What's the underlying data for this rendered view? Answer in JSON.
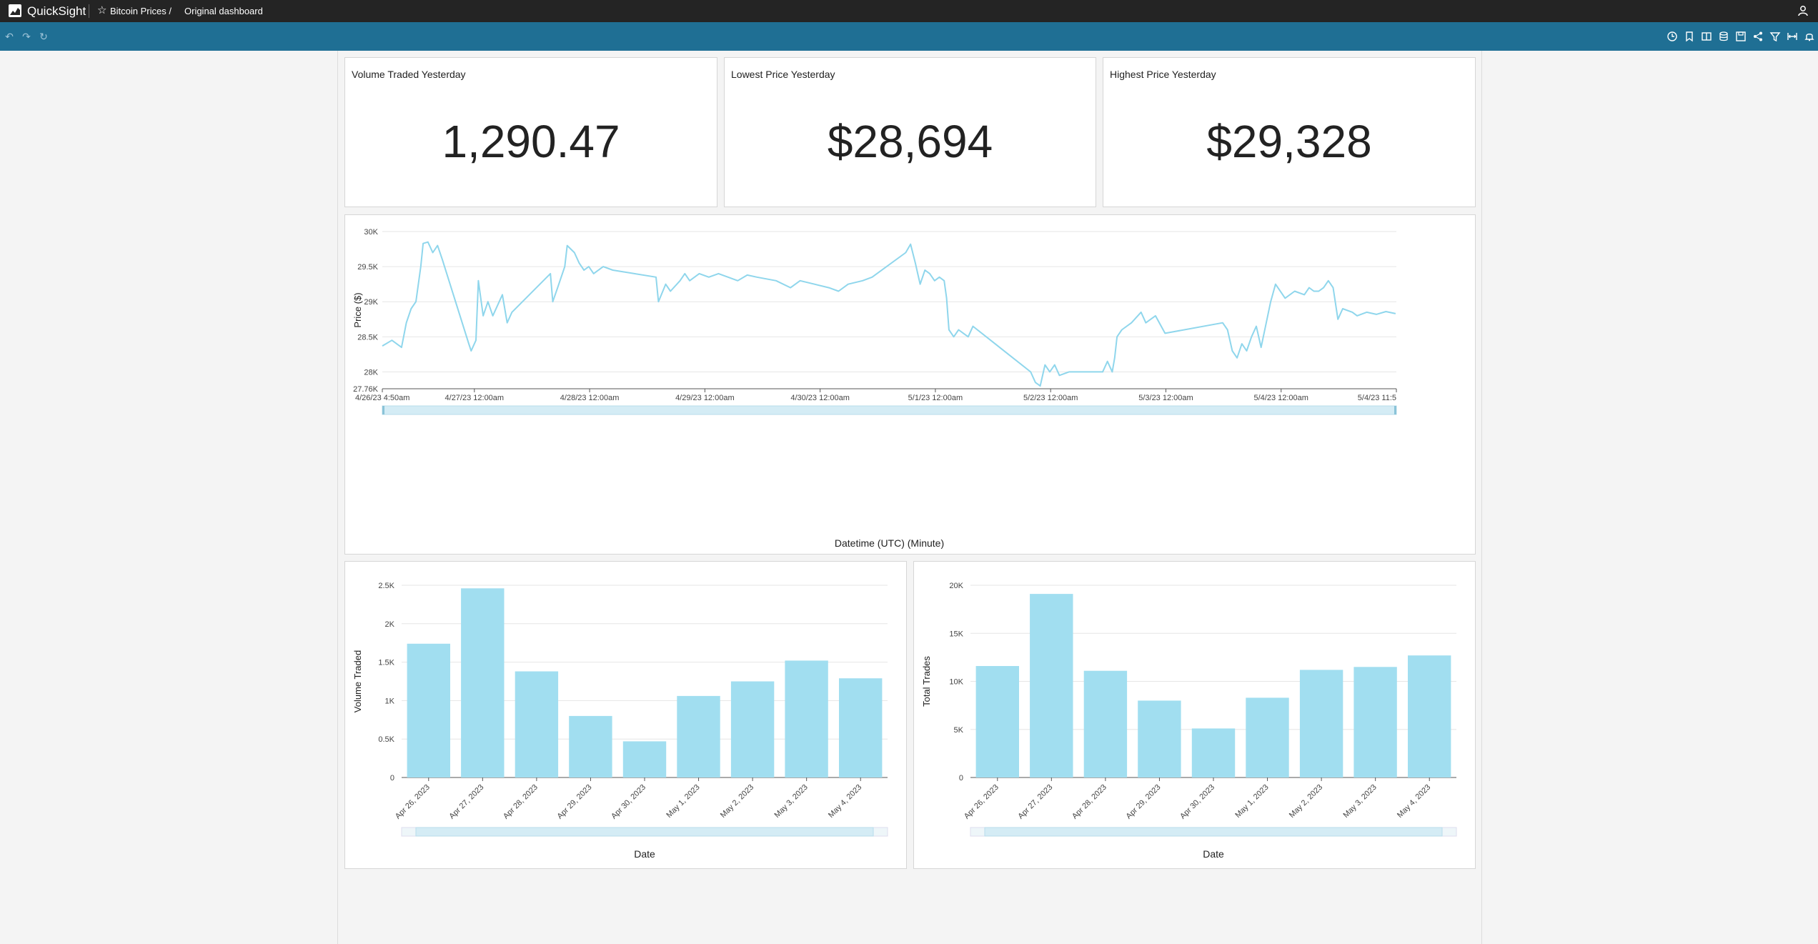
{
  "app": {
    "name": "QuickSight",
    "breadcrumb": "Bitcoin Prices /",
    "dashboard_title": "Original dashboard"
  },
  "toolbar": {
    "left_icons": [
      "undo-icon",
      "redo-icon",
      "reset-icon"
    ],
    "right_icons": [
      "clock-icon",
      "bookmark-icon",
      "thresholds-icon",
      "data-icon",
      "save-icon",
      "share-icon",
      "filter-icon",
      "fit-width-icon",
      "alert-icon"
    ]
  },
  "kpis": [
    {
      "title": "Volume Traded Yesterday",
      "value": "1,290.47"
    },
    {
      "title": "Lowest Price Yesterday",
      "value": "$28,694"
    },
    {
      "title": "Highest Price Yesterday",
      "value": "$29,328"
    }
  ],
  "colors": {
    "series": "#8fd6ec",
    "bar": "#a1def0",
    "topbar": "#242424",
    "toolbar": "#1f6f94"
  },
  "chart_data": [
    {
      "type": "line",
      "ylabel": "Price ($)",
      "xlabel": "Datetime (UTC) (Minute)",
      "y_ticks": [
        "27.76K",
        "28K",
        "28.5K",
        "29K",
        "29.5K",
        "30K"
      ],
      "ylim": [
        27760,
        30000
      ],
      "x_ticks": [
        "4/26/23 4:50am",
        "4/27/23 12:00am",
        "4/28/23 12:00am",
        "4/29/23 12:00am",
        "4/30/23 12:00am",
        "5/1/23 12:00am",
        "5/2/23 12:00am",
        "5/3/23 12:00am",
        "5/4/23 12:00am",
        "5/4/23 11:5"
      ],
      "x_hours": [
        0,
        19.17,
        43.17,
        67.17,
        91.17,
        115.17,
        139.17,
        163.17,
        187.17,
        211.17
      ],
      "grid": true,
      "points": [
        [
          0,
          28370
        ],
        [
          2,
          28450
        ],
        [
          4,
          28350
        ],
        [
          5,
          28700
        ],
        [
          6,
          28900
        ],
        [
          7,
          29000
        ],
        [
          8,
          29500
        ],
        [
          8.5,
          29830
        ],
        [
          9.5,
          29850
        ],
        [
          10.5,
          29700
        ],
        [
          11.5,
          29800
        ],
        [
          12.5,
          29600
        ],
        [
          18,
          28400
        ],
        [
          18.5,
          28300
        ],
        [
          19.5,
          28450
        ],
        [
          20,
          29300
        ],
        [
          21,
          28800
        ],
        [
          22,
          29000
        ],
        [
          23,
          28800
        ],
        [
          25,
          29100
        ],
        [
          26,
          28700
        ],
        [
          27,
          28850
        ],
        [
          35,
          29400
        ],
        [
          35.5,
          29000
        ],
        [
          36.5,
          29200
        ],
        [
          38,
          29500
        ],
        [
          38.5,
          29800
        ],
        [
          40,
          29700
        ],
        [
          41,
          29550
        ],
        [
          42,
          29450
        ],
        [
          43,
          29500
        ],
        [
          44,
          29400
        ],
        [
          46,
          29500
        ],
        [
          48,
          29450
        ],
        [
          57,
          29350
        ],
        [
          57.5,
          29000
        ],
        [
          59,
          29250
        ],
        [
          60,
          29150
        ],
        [
          62,
          29300
        ],
        [
          63,
          29400
        ],
        [
          64,
          29300
        ],
        [
          66,
          29400
        ],
        [
          68,
          29350
        ],
        [
          70,
          29400
        ],
        [
          72,
          29350
        ],
        [
          74,
          29300
        ],
        [
          76,
          29380
        ],
        [
          78,
          29350
        ],
        [
          82,
          29300
        ],
        [
          85,
          29200
        ],
        [
          87,
          29300
        ],
        [
          90,
          29250
        ],
        [
          93,
          29200
        ],
        [
          95,
          29150
        ],
        [
          97,
          29250
        ],
        [
          100,
          29300
        ],
        [
          102,
          29350
        ],
        [
          109,
          29700
        ],
        [
          110,
          29820
        ],
        [
          111,
          29550
        ],
        [
          111.5,
          29400
        ],
        [
          112,
          29250
        ],
        [
          113,
          29450
        ],
        [
          114,
          29400
        ],
        [
          115,
          29300
        ],
        [
          116,
          29350
        ],
        [
          117,
          29300
        ],
        [
          117.5,
          29050
        ],
        [
          118,
          28600
        ],
        [
          119,
          28500
        ],
        [
          120,
          28600
        ],
        [
          121,
          28550
        ],
        [
          122,
          28500
        ],
        [
          123,
          28650
        ],
        [
          135,
          28000
        ],
        [
          136,
          27850
        ],
        [
          137,
          27800
        ],
        [
          138,
          28100
        ],
        [
          139,
          28000
        ],
        [
          140,
          28100
        ],
        [
          141,
          27950
        ],
        [
          143,
          28000
        ],
        [
          150,
          28000
        ],
        [
          151,
          28150
        ],
        [
          152,
          28000
        ],
        [
          152.5,
          28200
        ],
        [
          153,
          28500
        ],
        [
          154,
          28600
        ],
        [
          156,
          28700
        ],
        [
          158,
          28850
        ],
        [
          159,
          28700
        ],
        [
          161,
          28800
        ],
        [
          163,
          28550
        ],
        [
          175,
          28700
        ],
        [
          176,
          28600
        ],
        [
          177,
          28300
        ],
        [
          178,
          28200
        ],
        [
          179,
          28400
        ],
        [
          180,
          28300
        ],
        [
          181,
          28500
        ],
        [
          182,
          28650
        ],
        [
          183,
          28350
        ],
        [
          185,
          29000
        ],
        [
          186,
          29250
        ],
        [
          188,
          29050
        ],
        [
          190,
          29150
        ],
        [
          192,
          29100
        ],
        [
          193,
          29200
        ],
        [
          194,
          29150
        ],
        [
          195,
          29150
        ],
        [
          196,
          29200
        ],
        [
          197,
          29300
        ],
        [
          198,
          29200
        ],
        [
          199,
          28750
        ],
        [
          200,
          28900
        ],
        [
          202,
          28850
        ],
        [
          203,
          28800
        ],
        [
          205,
          28850
        ],
        [
          207,
          28820
        ],
        [
          209,
          28860
        ],
        [
          211,
          28830
        ]
      ]
    },
    {
      "type": "bar",
      "ylabel": "Volume Traded",
      "xlabel": "Date",
      "categories": [
        "Apr 26, 2023",
        "Apr 27, 2023",
        "Apr 28, 2023",
        "Apr 29, 2023",
        "Apr 30, 2023",
        "May 1, 2023",
        "May 2, 2023",
        "May 3, 2023",
        "May 4, 2023"
      ],
      "values": [
        1740,
        2460,
        1380,
        800,
        470,
        1060,
        1250,
        1520,
        1290
      ],
      "y_ticks": [
        "0",
        "0.5K",
        "1K",
        "1.5K",
        "2K",
        "2.5K"
      ],
      "ylim": [
        0,
        2500
      ],
      "grid": true
    },
    {
      "type": "bar",
      "ylabel": "Total Trades",
      "xlabel": "Date",
      "categories": [
        "Apr 26, 2023",
        "Apr 27, 2023",
        "Apr 28, 2023",
        "Apr 29, 2023",
        "Apr 30, 2023",
        "May 1, 2023",
        "May 2, 2023",
        "May 3, 2023",
        "May 4, 2023"
      ],
      "values": [
        11600,
        19100,
        11100,
        8000,
        5100,
        8300,
        11200,
        11500,
        12700
      ],
      "y_ticks": [
        "0",
        "5K",
        "10K",
        "15K",
        "20K"
      ],
      "ylim": [
        0,
        20000
      ],
      "grid": true
    }
  ]
}
